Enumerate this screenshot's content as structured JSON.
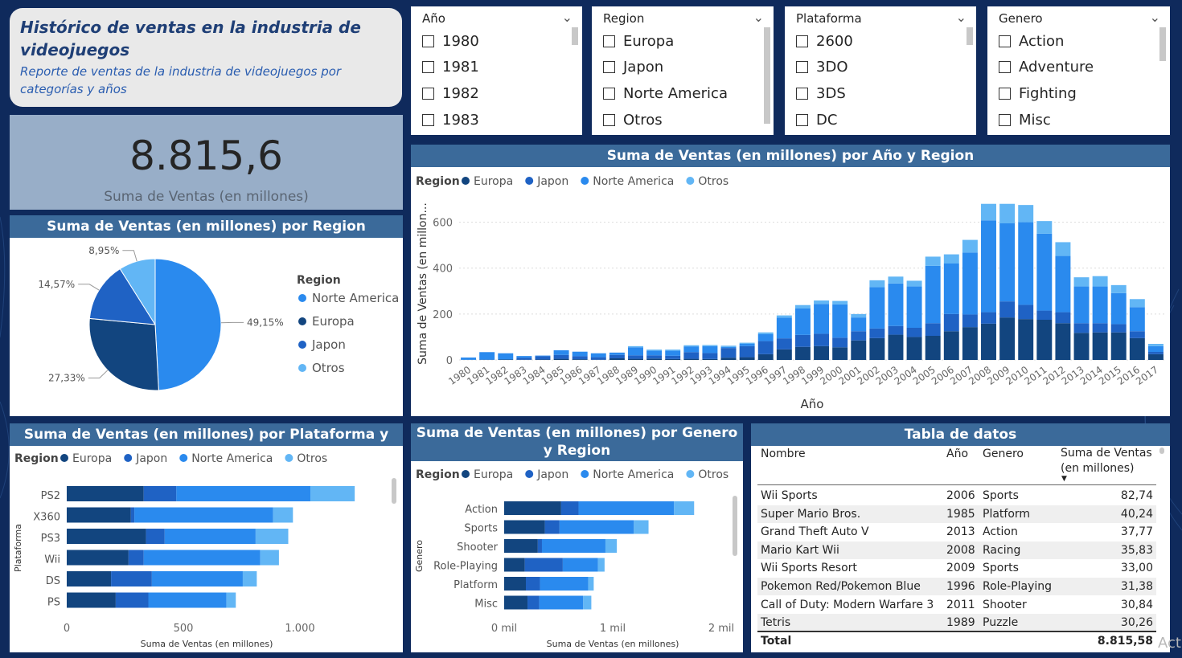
{
  "header": {
    "title": "Histórico de ventas en la industria de videojuegos",
    "subtitle": "Reporte de ventas de la industria de videojuegos por categorías y años"
  },
  "kpi": {
    "value": "8.815,6",
    "label": "Suma de Ventas (en millones)"
  },
  "slicers": [
    {
      "title": "Año",
      "items": [
        "1980",
        "1981",
        "1982",
        "1983"
      ]
    },
    {
      "title": "Region",
      "items": [
        "Europa",
        "Japon",
        "Norte America",
        "Otros"
      ]
    },
    {
      "title": "Plataforma",
      "items": [
        "2600",
        "3DO",
        "3DS",
        "DC"
      ]
    },
    {
      "title": "Genero",
      "items": [
        "Action",
        "Adventure",
        "Fighting",
        "Misc"
      ]
    }
  ],
  "colors": {
    "Europa": "#12457f",
    "Japon": "#1f62c4",
    "Norte America": "#2a8aee",
    "Otros": "#62b6f5"
  },
  "chart_data": [
    {
      "type": "bar",
      "title": "Suma de Ventas (en millones) por Año y Region",
      "legend_title": "Region",
      "xlabel": "Año",
      "ylabel": "Suma de Ventas (en millon...",
      "ylim": [
        0,
        700
      ],
      "yticks": [
        0,
        200,
        400,
        600
      ],
      "stacked": true,
      "categories": [
        "1980",
        "1981",
        "1982",
        "1983",
        "1984",
        "1985",
        "1986",
        "1987",
        "1988",
        "1989",
        "1990",
        "1991",
        "1992",
        "1993",
        "1994",
        "1995",
        "1996",
        "1997",
        "1998",
        "1999",
        "2000",
        "2001",
        "2002",
        "2003",
        "2004",
        "2005",
        "2006",
        "2007",
        "2008",
        "2009",
        "2010",
        "2011",
        "2012",
        "2013",
        "2014",
        "2015",
        "2016",
        "2017"
      ],
      "series": [
        {
          "name": "Europa",
          "values": [
            0.5,
            1,
            2,
            1,
            2,
            5,
            3,
            1,
            7,
            5,
            6,
            4,
            5,
            4,
            10,
            12,
            25,
            46,
            57,
            60,
            55,
            85,
            95,
            110,
            100,
            105,
            125,
            143,
            158,
            185,
            178,
            175,
            160,
            118,
            120,
            120,
            95,
            25
          ]
        },
        {
          "name": "Japon",
          "values": [
            0,
            0,
            0,
            8,
            14,
            17,
            13,
            11,
            15,
            15,
            14,
            14,
            29,
            26,
            42,
            48,
            57,
            48,
            52,
            54,
            42,
            40,
            42,
            38,
            40,
            55,
            75,
            55,
            50,
            70,
            62,
            40,
            48,
            42,
            40,
            36,
            30,
            10
          ]
        },
        {
          "name": "Norte America",
          "values": [
            10,
            33,
            27,
            8,
            3,
            20,
            20,
            17,
            10,
            35,
            20,
            22,
            25,
            30,
            5,
            10,
            30,
            90,
            115,
            130,
            145,
            60,
            180,
            185,
            180,
            250,
            220,
            270,
            400,
            340,
            360,
            335,
            245,
            160,
            160,
            135,
            105,
            25
          ]
        },
        {
          "name": "Otros",
          "values": [
            0,
            0,
            0,
            0,
            0,
            0,
            0,
            0,
            0,
            5,
            5,
            5,
            5,
            5,
            5,
            5,
            8,
            10,
            15,
            15,
            15,
            15,
            30,
            30,
            25,
            40,
            40,
            55,
            72,
            85,
            75,
            55,
            60,
            40,
            45,
            35,
            35,
            10
          ]
        }
      ]
    },
    {
      "type": "pie",
      "title": "Suma de Ventas (en millones) por Region",
      "legend_title": "Region",
      "legend_order": [
        "Norte America",
        "Europa",
        "Japon",
        "Otros"
      ],
      "slices": [
        {
          "name": "Norte America",
          "value": 49.15,
          "label": "49,15%"
        },
        {
          "name": "Europa",
          "value": 27.33,
          "label": "27,33%"
        },
        {
          "name": "Japon",
          "value": 14.57,
          "label": "14,57%"
        },
        {
          "name": "Otros",
          "value": 8.95,
          "label": "8,95%"
        }
      ]
    },
    {
      "type": "bar",
      "orientation": "horizontal",
      "stacked": true,
      "title": "Suma de Ventas (en millones) por Plataforma y Region",
      "legend_title": "Region",
      "xlabel": "Suma de Ventas (en millones)",
      "ylabel": "Plataforma",
      "xlim": [
        0,
        1200
      ],
      "xticks": [
        0,
        500,
        1000
      ],
      "xtick_labels": [
        "0",
        "500",
        "1.000"
      ],
      "categories": [
        "PS2",
        "X360",
        "PS3",
        "Wii",
        "DS",
        "PS"
      ],
      "series": [
        {
          "name": "Europa",
          "values": [
            330,
            275,
            340,
            265,
            190,
            210
          ]
        },
        {
          "name": "Japon",
          "values": [
            140,
            15,
            80,
            65,
            175,
            140
          ]
        },
        {
          "name": "Norte America",
          "values": [
            575,
            595,
            390,
            500,
            390,
            335
          ]
        },
        {
          "name": "Otros",
          "values": [
            190,
            85,
            140,
            80,
            60,
            40
          ]
        }
      ]
    },
    {
      "type": "bar",
      "orientation": "horizontal",
      "stacked": true,
      "title": "Suma de Ventas (en millones) por Genero y Region",
      "legend_title": "Region",
      "xlabel": "Suma de Ventas (en millones)",
      "ylabel": "Genero",
      "xlim": [
        0,
        2000
      ],
      "xticks": [
        0,
        1000,
        2000
      ],
      "xtick_labels": [
        "0 mil",
        "1 mil",
        "2 mil"
      ],
      "categories": [
        "Action",
        "Sports",
        "Shooter",
        "Role-Playing",
        "Platform",
        "Misc"
      ],
      "series": [
        {
          "name": "Europa",
          "values": [
            525,
            375,
            310,
            190,
            200,
            215
          ]
        },
        {
          "name": "Japon",
          "values": [
            160,
            135,
            38,
            350,
            130,
            108
          ]
        },
        {
          "name": "Norte America",
          "values": [
            880,
            685,
            585,
            325,
            445,
            405
          ]
        },
        {
          "name": "Otros",
          "values": [
            185,
            135,
            105,
            60,
            50,
            75
          ]
        }
      ]
    }
  ],
  "table": {
    "title": "Tabla de datos",
    "columns": [
      "Nombre",
      "Año",
      "Genero",
      "Suma de Ventas (en millones)"
    ],
    "rows": [
      [
        "Wii Sports",
        "2006",
        "Sports",
        "82,74"
      ],
      [
        "Super Mario Bros.",
        "1985",
        "Platform",
        "40,24"
      ],
      [
        "Grand Theft Auto V",
        "2013",
        "Action",
        "37,77"
      ],
      [
        "Mario Kart Wii",
        "2008",
        "Racing",
        "35,83"
      ],
      [
        "Wii Sports Resort",
        "2009",
        "Sports",
        "33,00"
      ],
      [
        "Pokemon Red/Pokemon Blue",
        "1996",
        "Role-Playing",
        "31,38"
      ],
      [
        "Call of Duty: Modern Warfare 3",
        "2011",
        "Shooter",
        "30,84"
      ],
      [
        "Tetris",
        "1989",
        "Puzzle",
        "30,26"
      ]
    ],
    "total_label": "Total",
    "total_value": "8.815,58"
  },
  "watermark": "Act"
}
